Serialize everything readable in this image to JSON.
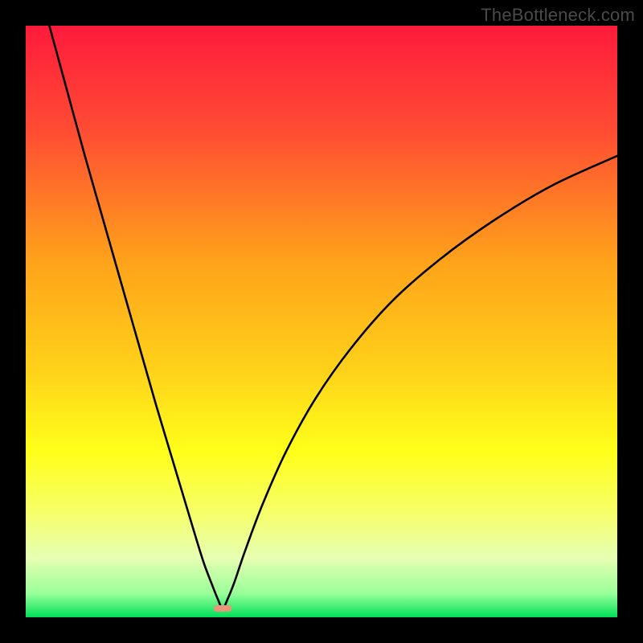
{
  "watermark": "TheBottleneck.com",
  "chart_data": {
    "type": "line",
    "title": "",
    "xlabel": "",
    "ylabel": "",
    "xlim": [
      0,
      100
    ],
    "ylim": [
      0,
      100
    ],
    "grid": false,
    "legend": false,
    "description": "Single black V-shaped curve over a vertical rainbow gradient (red top → green bottom). Left branch starts at x≈4, y=100 and descends steeply to a minimum near x≈33, y≈1.5. Right branch rises with decreasing slope to x=100, y≈78. A small salmon tick sits at the minimum. Axes are unlabeled black margins.",
    "gradient_stops": [
      {
        "offset": 0.0,
        "color": "#ff1a3c"
      },
      {
        "offset": 0.18,
        "color": "#ff4d33"
      },
      {
        "offset": 0.4,
        "color": "#ffa31a"
      },
      {
        "offset": 0.58,
        "color": "#ffd11a"
      },
      {
        "offset": 0.72,
        "color": "#ffff1a"
      },
      {
        "offset": 0.82,
        "color": "#f7ff66"
      },
      {
        "offset": 0.9,
        "color": "#e6ffb3"
      },
      {
        "offset": 0.96,
        "color": "#99ff99"
      },
      {
        "offset": 1.0,
        "color": "#00e05a"
      }
    ],
    "curve": {
      "x": [
        4.0,
        7,
        10,
        13,
        16,
        19,
        22,
        25,
        28,
        30,
        31.5,
        32.5,
        33.3,
        34.1,
        35.3,
        37,
        40,
        44,
        49,
        55,
        62,
        70,
        79,
        89,
        100
      ],
      "y": [
        100,
        89,
        78,
        67.5,
        57,
        46.5,
        36,
        26,
        16,
        9.5,
        5.5,
        3.0,
        1.5,
        3.0,
        6.0,
        11,
        19,
        28,
        37,
        45.5,
        53.5,
        60.5,
        67,
        73,
        78
      ]
    },
    "minimum_marker": {
      "x": 33.3,
      "y": 1.5,
      "color": "#e9967a"
    }
  }
}
